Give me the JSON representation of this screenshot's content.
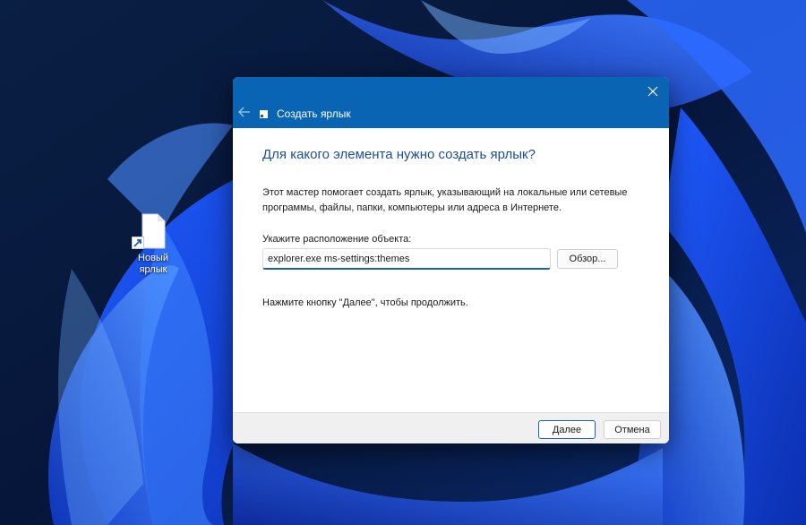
{
  "desktop": {
    "shortcut_label": "Новый ярлык"
  },
  "dialog": {
    "title": "Создать ярлык",
    "heading": "Для какого элемента нужно создать ярлык?",
    "description": "Этот мастер помогает создать ярлык, указывающий на локальные или сетевые программы, файлы, папки, компьютеры или адреса в Интернете.",
    "location_label": "Укажите расположение объекта:",
    "location_value": "explorer.exe ms-settings:themes",
    "browse_label": "Обзор...",
    "hint": "Нажмите кнопку \"Далее\", чтобы продолжить.",
    "next_label": "Далее",
    "cancel_label": "Отмена"
  },
  "icons": {
    "close": "close-icon",
    "back": "back-arrow-icon",
    "title": "shortcut-icon",
    "file": "file-icon",
    "shortcut_arrow": "shortcut-arrow-icon"
  },
  "colors": {
    "titlebar": "#0a64b4",
    "accent": "#1e5fb6",
    "heading": "#1b4f9a",
    "desktop_bg": "#071a3a",
    "wallpaper_blue": "#1a4fe0"
  }
}
